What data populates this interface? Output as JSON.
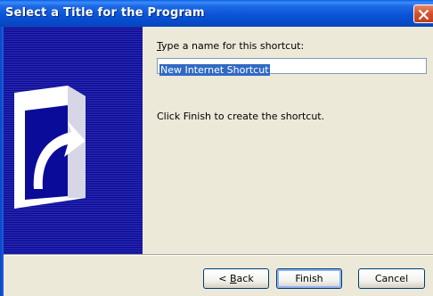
{
  "window": {
    "title": "Select a Title for the Program"
  },
  "content": {
    "name_label_accel": "T",
    "name_label_rest": "ype a name for this shortcut:",
    "name_value": "New Internet Shortcut",
    "instruction": "Click Finish to create the shortcut."
  },
  "buttons": {
    "back_prefix": "< ",
    "back_accel": "B",
    "back_rest": "ack",
    "finish": "Finish",
    "cancel": "Cancel"
  },
  "icons": {
    "close": "close-icon",
    "banner": "shortcut-arrow-icon"
  },
  "colors": {
    "titlebar": "#0a54d8",
    "banner": "#0b0b99",
    "selection": "#316ac5",
    "close_button": "#d5542e",
    "dialog_background": "#ece9d8"
  }
}
